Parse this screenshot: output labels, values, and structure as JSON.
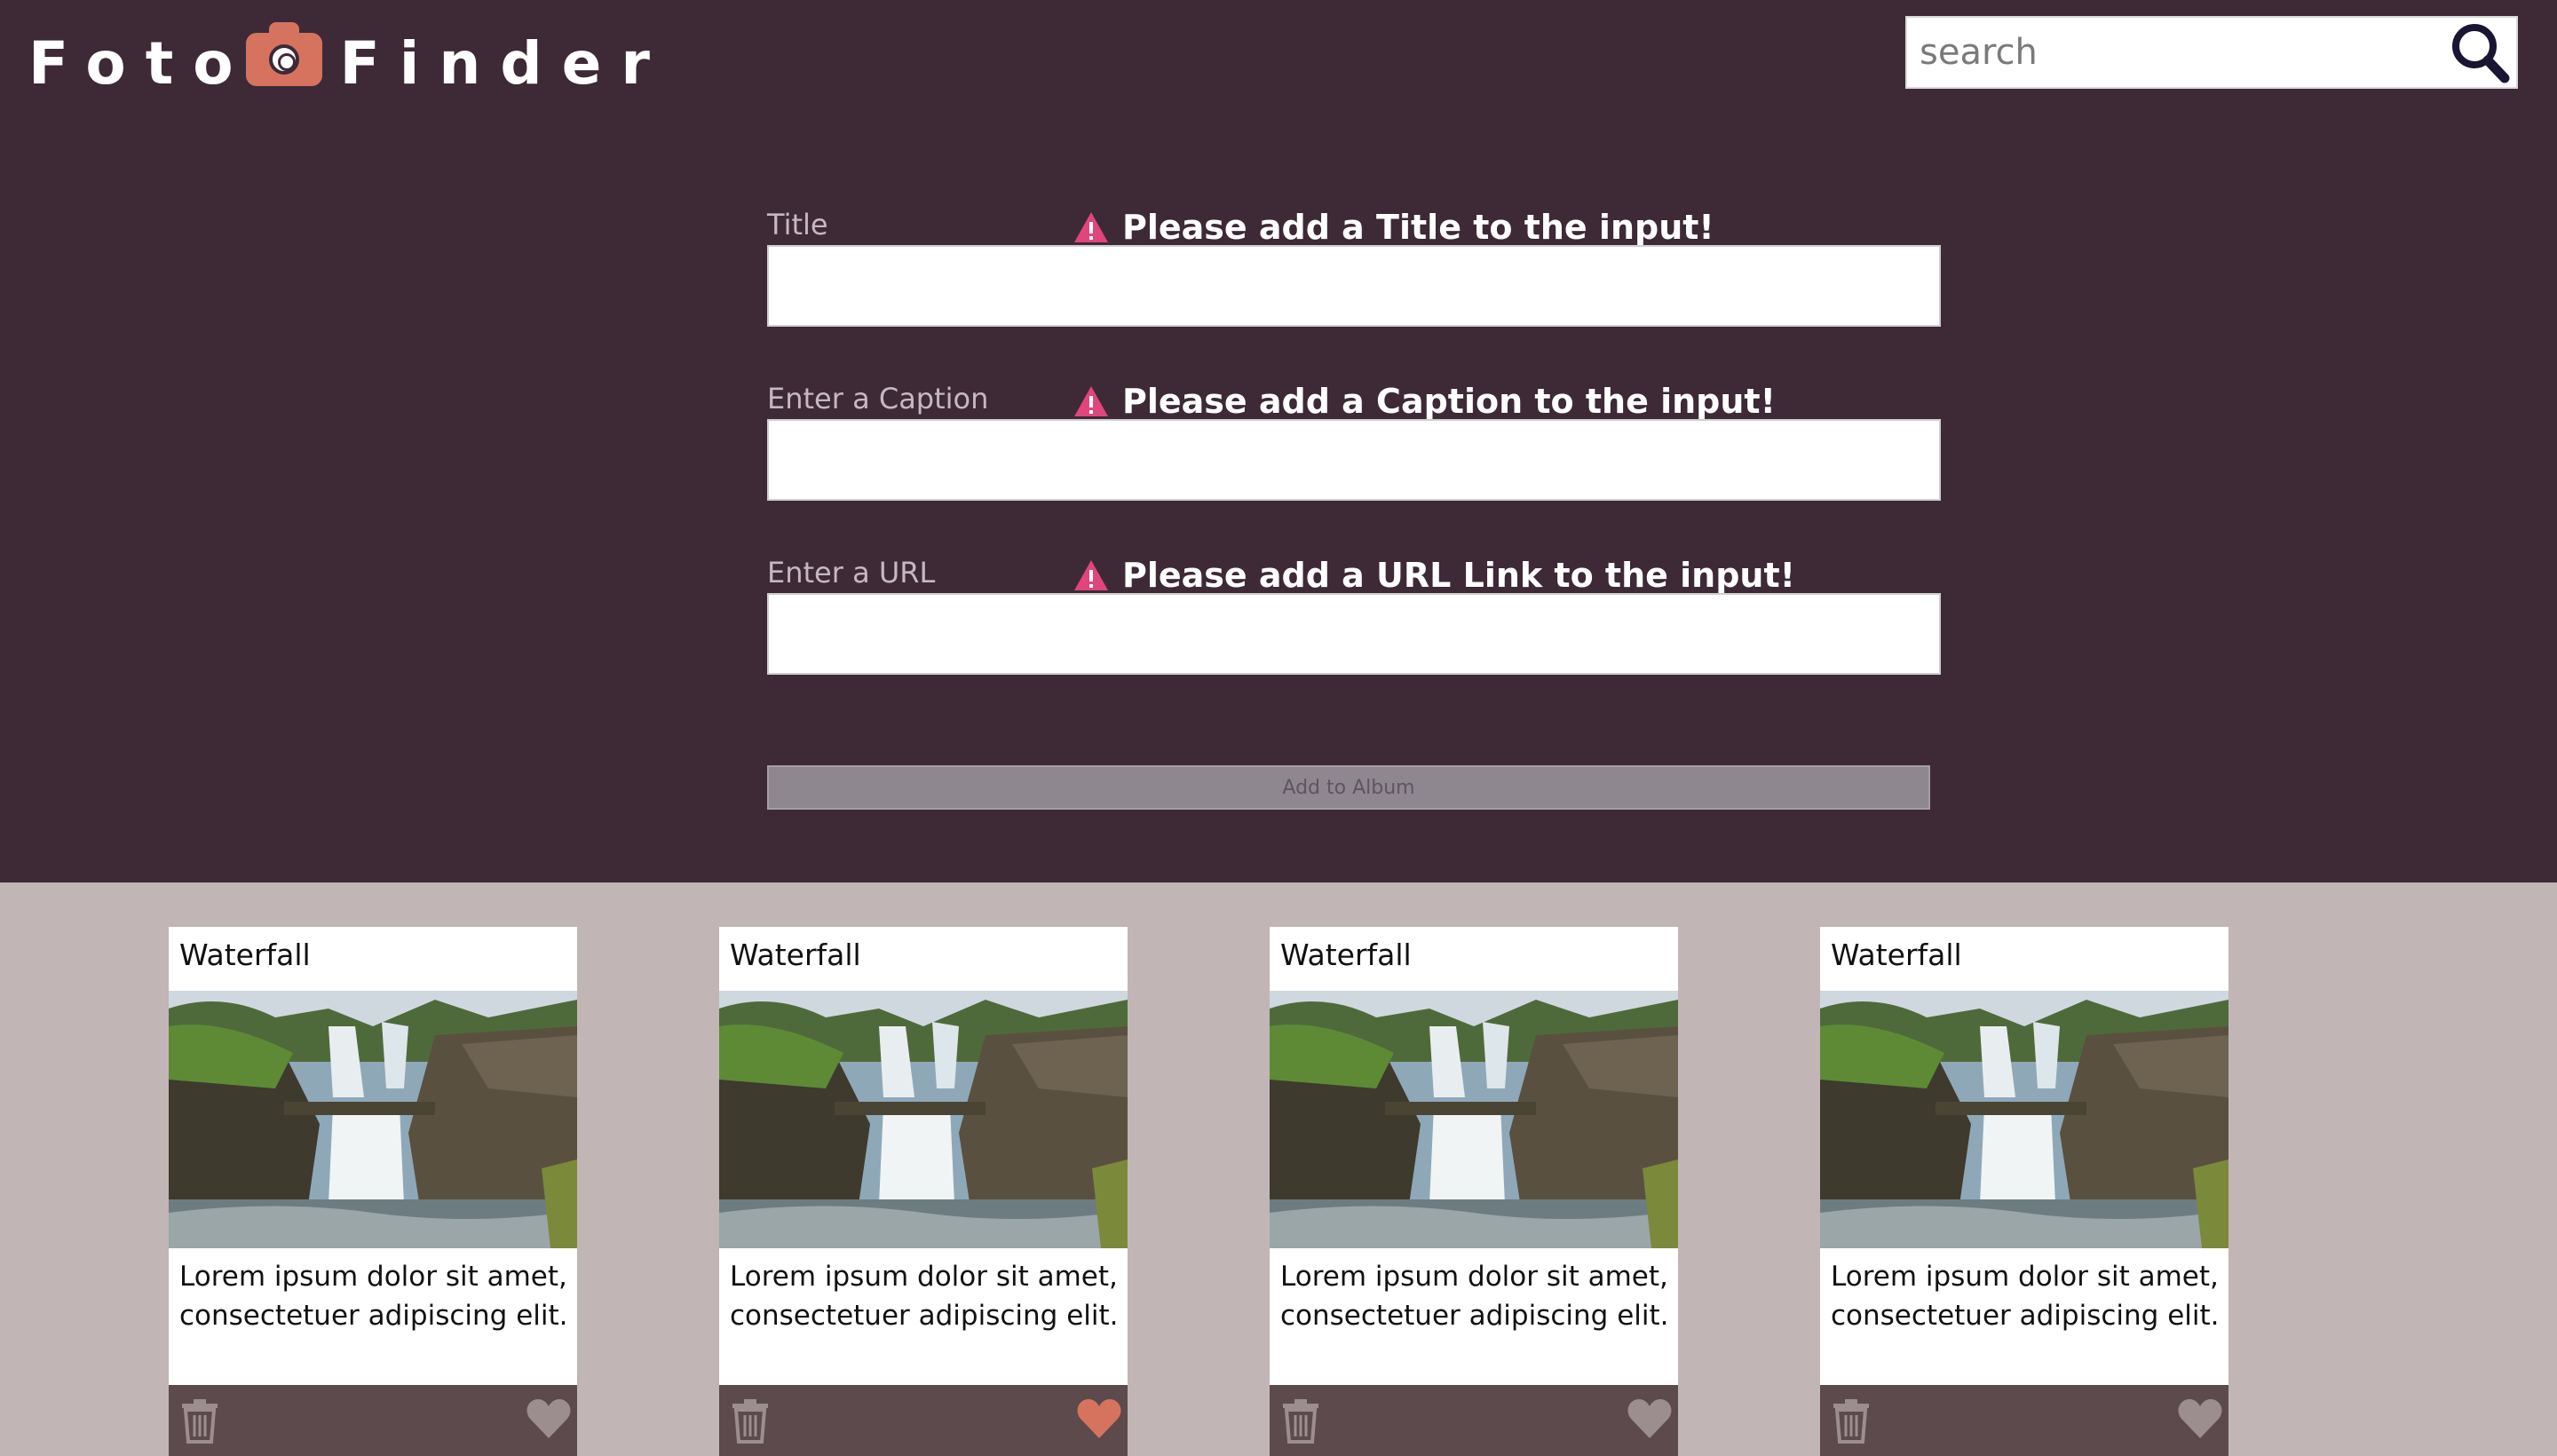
{
  "app": {
    "logo_left": "Foto",
    "logo_right": "Finder"
  },
  "search": {
    "placeholder": "search"
  },
  "form": {
    "title_label": "Title",
    "title_warning": "Please add a Title to the input!",
    "caption_label": "Enter a Caption",
    "caption_warning": "Please add a Caption to the input!",
    "url_label": "Enter a URL",
    "url_warning": "Please add a URL Link to the input!",
    "add_button": "Add to Album"
  },
  "cards": [
    {
      "title": "Waterfall",
      "caption": "Lorem ipsum dolor sit amet, consectetuer adipiscing elit.",
      "favorite": false
    },
    {
      "title": "Waterfall",
      "caption": "Lorem ipsum dolor sit amet, consectetuer adipiscing elit.",
      "favorite": true
    },
    {
      "title": "Waterfall",
      "caption": "Lorem ipsum dolor sit amet, consectetuer adipiscing elit.",
      "favorite": false
    },
    {
      "title": "Waterfall",
      "caption": "Lorem ipsum dolor sit amet, consectetuer adipiscing elit.",
      "favorite": false
    }
  ],
  "colors": {
    "header_bg": "#3d2a36",
    "album_bg": "#c1b5b5",
    "accent": "#d6735e",
    "warning": "#e0457b",
    "card_footer": "#5c4a4c",
    "icon_inactive": "#9c8e8f"
  },
  "icons": {
    "logo": "camera-icon",
    "search": "magnifier-icon",
    "warning": "warning-triangle-icon",
    "delete": "trash-icon",
    "favorite": "heart-icon"
  }
}
